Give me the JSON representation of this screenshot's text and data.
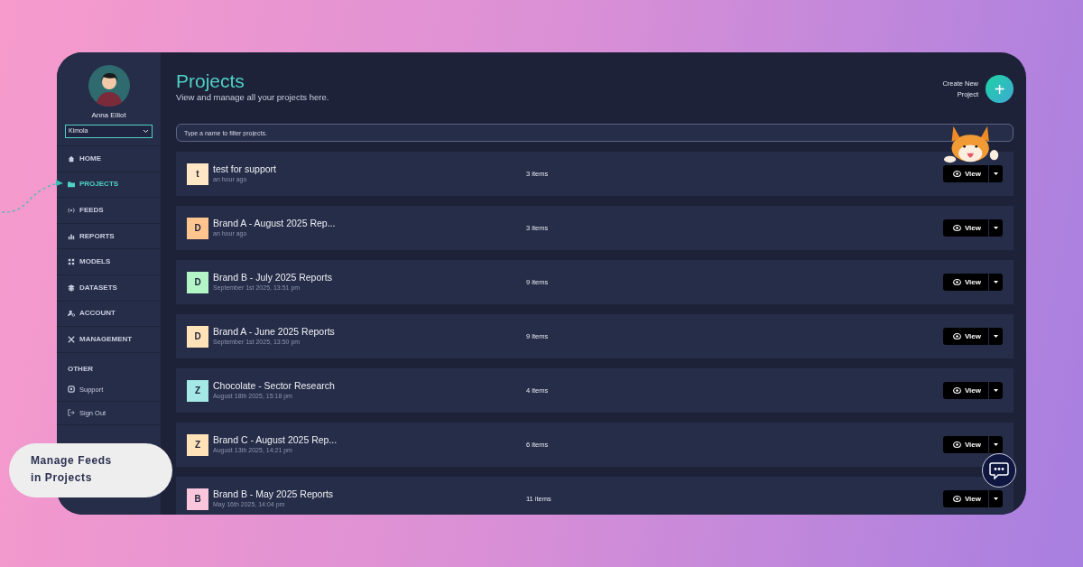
{
  "sidebar": {
    "user_name": "Anna Elliot",
    "workspace": "Kimola",
    "nav": [
      {
        "label": "HOME",
        "selected": false
      },
      {
        "label": "PROJECTS",
        "selected": true
      },
      {
        "label": "FEEDS",
        "selected": false
      },
      {
        "label": "REPORTS",
        "selected": false
      },
      {
        "label": "MODELS",
        "selected": false
      },
      {
        "label": "DATASETS",
        "selected": false
      },
      {
        "label": "ACCOUNT",
        "selected": false
      },
      {
        "label": "MANAGEMENT",
        "selected": false
      }
    ],
    "other": {
      "heading": "OTHER",
      "items": [
        "Support",
        "Sign Out"
      ]
    }
  },
  "header": {
    "title": "Projects",
    "subtitle": "View and manage all your projects here.",
    "create_label": "Create New Project",
    "create_button": "+"
  },
  "search": {
    "placeholder": "Type a name to filter projects."
  },
  "projects": [
    {
      "initial": "t",
      "color": "#ffe7c6",
      "name": "test for support",
      "date": "an hour ago",
      "count": "3 items",
      "action": "View"
    },
    {
      "initial": "D",
      "color": "#ffc58f",
      "name": "Brand A - August 2025 Rep...",
      "date": "an hour ago",
      "count": "3 items",
      "action": "View"
    },
    {
      "initial": "D",
      "color": "#b4f5c8",
      "name": "Brand B - July 2025 Reports",
      "date": "September 1st 2025, 13:51 pm",
      "count": "9 items",
      "action": "View"
    },
    {
      "initial": "D",
      "color": "#ffe2b8",
      "name": "Brand A - June 2025 Reports",
      "date": "September 1st 2025, 13:50 pm",
      "count": "9 items",
      "action": "View"
    },
    {
      "initial": "Z",
      "color": "#a4e9e6",
      "name": "Chocolate - Sector Research",
      "date": "August 18th 2025, 15:18 pm",
      "count": "4 items",
      "action": "View"
    },
    {
      "initial": "Z",
      "color": "#ffe2b8",
      "name": "Brand C - August 2025 Rep...",
      "date": "August 13th 2025, 14:21 pm",
      "count": "6 items",
      "action": "View"
    },
    {
      "initial": "B",
      "color": "#f9c6dc",
      "name": "Brand B - May 2025 Reports",
      "date": "May 16th 2025, 14:04 pm",
      "count": "11 items",
      "action": "View"
    }
  ],
  "callout": "Manage Feeds in Projects"
}
